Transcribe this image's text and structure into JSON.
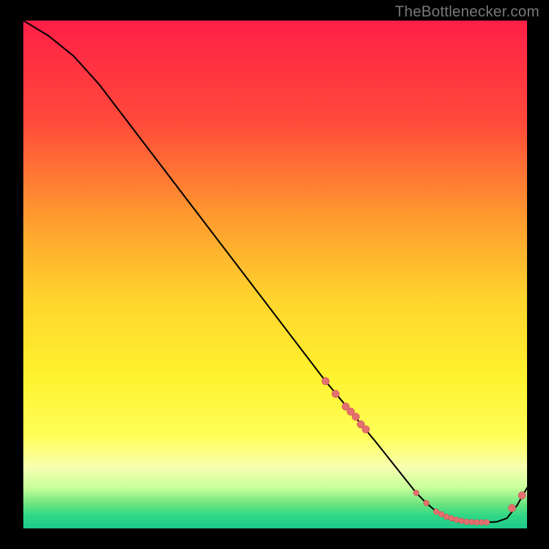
{
  "watermark": "TheBottlenecker.com",
  "colors": {
    "bg": "#000000",
    "watermark": "#777777",
    "curve": "#000000",
    "dot_fill": "#e36f6f",
    "dot_stroke": "#c94a4a",
    "gradient_stops": [
      {
        "offset": 0.0,
        "color": "#ff1f48"
      },
      {
        "offset": 0.2,
        "color": "#ff4a3a"
      },
      {
        "offset": 0.4,
        "color": "#ffa02e"
      },
      {
        "offset": 0.55,
        "color": "#ffd52e"
      },
      {
        "offset": 0.7,
        "color": "#fff22e"
      },
      {
        "offset": 0.82,
        "color": "#ffff5a"
      },
      {
        "offset": 0.88,
        "color": "#f7ffb0"
      },
      {
        "offset": 0.92,
        "color": "#c8ff9a"
      },
      {
        "offset": 0.955,
        "color": "#63e27e"
      },
      {
        "offset": 0.975,
        "color": "#2fd886"
      },
      {
        "offset": 1.0,
        "color": "#1ec98a"
      }
    ]
  },
  "chart_data": {
    "type": "line",
    "title": "",
    "xlabel": "",
    "ylabel": "",
    "x": [
      0,
      5,
      10,
      15,
      20,
      25,
      30,
      35,
      40,
      45,
      50,
      55,
      60,
      65,
      70,
      74,
      78,
      80,
      82,
      84,
      86,
      88,
      90,
      92,
      94,
      96,
      98,
      100
    ],
    "y": [
      100,
      97,
      93,
      87.5,
      81,
      74.5,
      68,
      61.5,
      55,
      48.5,
      42,
      35.5,
      29,
      23,
      17,
      12,
      7,
      5,
      3.3,
      2.1,
      1.4,
      1.2,
      1.2,
      1.2,
      1.3,
      2.0,
      4.5,
      8.0
    ],
    "x_range": [
      0,
      100
    ],
    "y_range": [
      0,
      100
    ],
    "markers": {
      "cluster_descending": {
        "x": [
          60,
          62,
          64,
          65,
          66,
          67,
          68
        ],
        "y": [
          29,
          26.5,
          24,
          23,
          22,
          20.5,
          19.5
        ]
      },
      "cluster_bottom": {
        "x": [
          78,
          80,
          82,
          83,
          84,
          85,
          86,
          87,
          88,
          89,
          90,
          91,
          92
        ],
        "y": [
          7,
          5,
          3.3,
          2.8,
          2.3,
          2.0,
          1.7,
          1.5,
          1.3,
          1.25,
          1.2,
          1.2,
          1.2
        ]
      },
      "upturn": {
        "x": [
          97,
          99
        ],
        "y": [
          4.0,
          6.5
        ]
      }
    }
  }
}
